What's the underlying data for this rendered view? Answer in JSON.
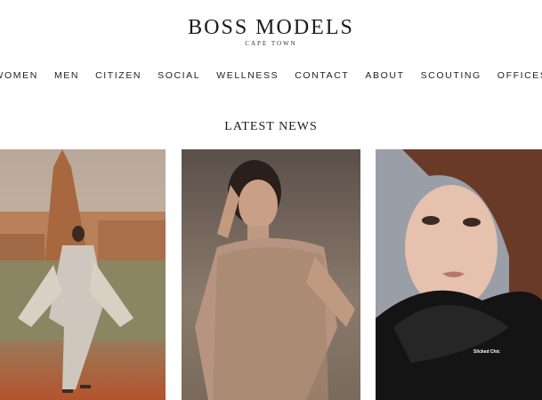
{
  "brand": {
    "title": "BOSS MODELS",
    "subtitle": "CAPE TOWN"
  },
  "nav": {
    "items": [
      {
        "label": "WOMEN"
      },
      {
        "label": "MEN"
      },
      {
        "label": "CITIZEN"
      },
      {
        "label": "SOCIAL"
      },
      {
        "label": "WELLNESS"
      },
      {
        "label": "CONTACT"
      },
      {
        "label": "ABOUT"
      },
      {
        "label": "SCOUTING"
      },
      {
        "label": "OFFICES"
      }
    ]
  },
  "news": {
    "heading": "LATEST NEWS",
    "tiles": [
      {
        "image": "model-in-desert-with-fringed-cape"
      },
      {
        "image": "model-in-lace-dress-on-sand"
      },
      {
        "image": "model-portrait-with-black-tulle",
        "caption": "Slicked Chic"
      }
    ]
  },
  "colors": {
    "text": "#222222",
    "background": "#ffffff"
  }
}
